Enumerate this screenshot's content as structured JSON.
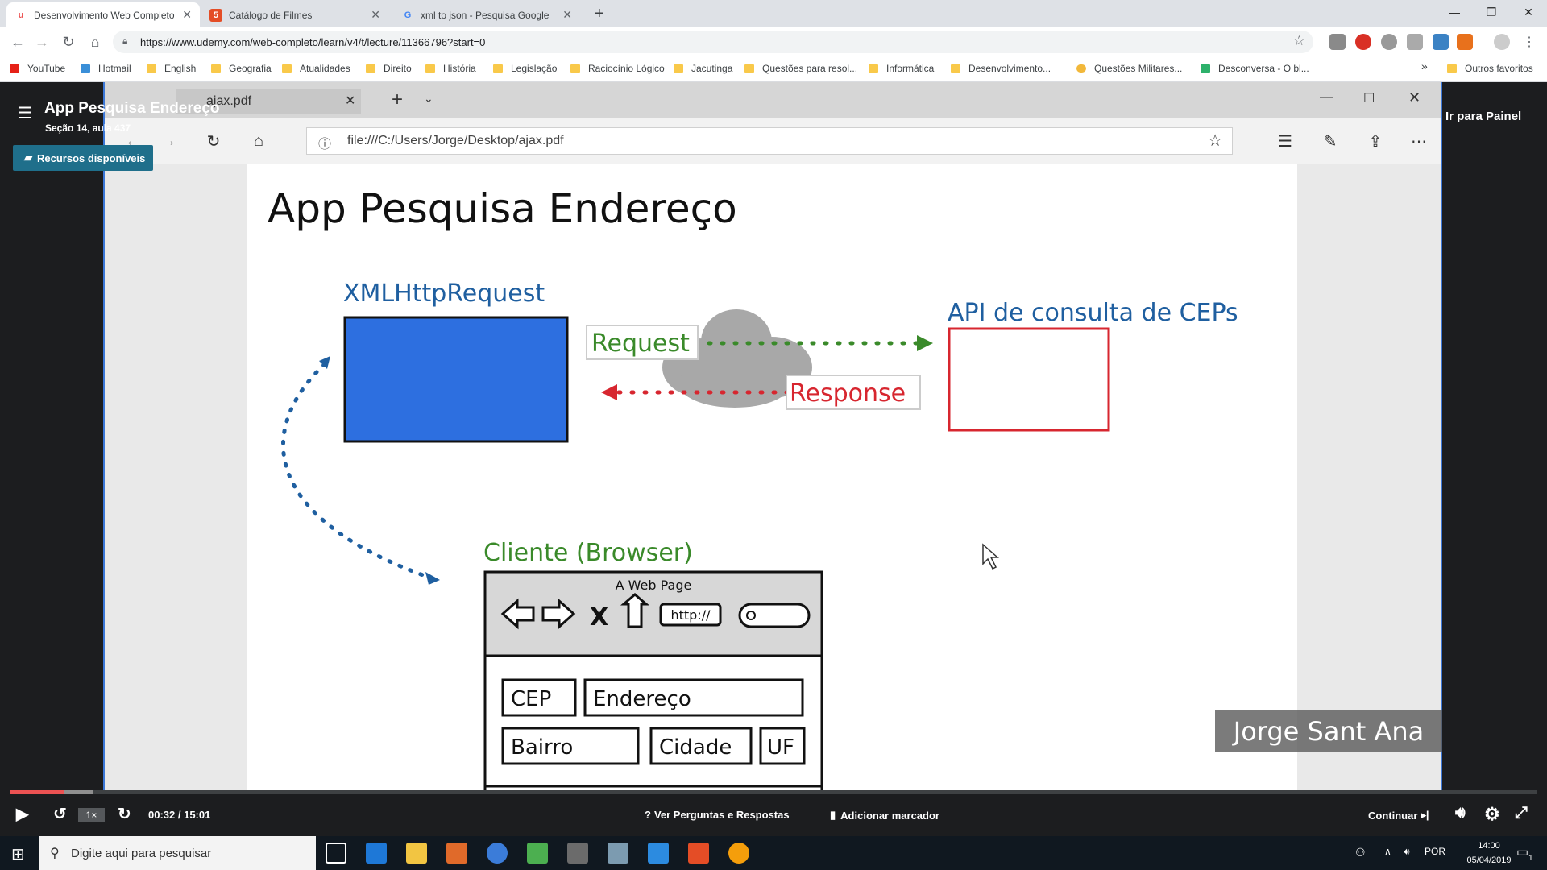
{
  "browser": {
    "tabs": [
      {
        "title": "Desenvolvimento Web Completo",
        "active": true
      },
      {
        "title": "Catálogo de Filmes",
        "active": false
      },
      {
        "title": "xml to json - Pesquisa Google",
        "active": false
      }
    ],
    "url": "https://www.udemy.com/web-completo/learn/v4/t/lecture/11366796?start=0",
    "bookmarks": [
      "YouTube",
      "Hotmail",
      "English",
      "Geografia",
      "Atualidades",
      "Direito",
      "História",
      "Legislação",
      "Raciocínio Lógico",
      "Jacutinga",
      "Questões para resol...",
      "Informática",
      "Desenvolvimento...",
      "Questões Militares...",
      "Desconversa - O bl..."
    ],
    "other_bookmarks": "Outros favoritos",
    "overflow": "»"
  },
  "course": {
    "title": "App Pesquisa Endereço",
    "section": "Seção 14, aula 437",
    "resources_label": "Recursos disponíveis",
    "dashboard_label": "Ir para Painel"
  },
  "edge": {
    "tab_title": "ajax.pdf",
    "url": "file:///C:/Users/Jorge/Desktop/ajax.pdf"
  },
  "slide": {
    "title": "App Pesquisa Endereço",
    "xhr_label": "XMLHttpRequest",
    "api_label": "API de consulta de CEPs",
    "request_label": "Request",
    "response_label": "Response",
    "client_label": "Cliente (Browser)",
    "mock_title": "A Web Page",
    "mock_url": "http://",
    "fields": [
      "CEP",
      "Endereço",
      "Bairro",
      "Cidade",
      "UF"
    ],
    "colors": {
      "xhr_fill": "#2d6fe0",
      "request": "#3a8a2a",
      "response": "#d7262f",
      "api_border": "#d7262f",
      "client": "#3a8a2a",
      "arrow": "#1f5fa0"
    }
  },
  "watermark": "Jorge Sant Ana",
  "player": {
    "time": "00:32 / 15:01",
    "progress_fraction": 0.0355,
    "buffer_fraction": 0.055,
    "speed": "1×",
    "qa_label": "Ver Perguntas e Respostas",
    "bookmark_label": "Adicionar marcador",
    "continue_label": "Continuar"
  },
  "taskbar": {
    "search_placeholder": "Digite aqui para pesquisar",
    "lang": "POR",
    "time": "14:00",
    "date": "05/04/2019",
    "notifications": "1"
  }
}
